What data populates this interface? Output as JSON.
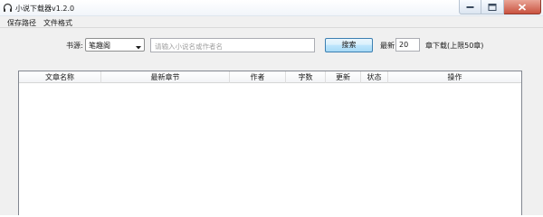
{
  "window": {
    "title": "小说下载器v1.2.0",
    "icon": "headphones-icon"
  },
  "menu": {
    "items": [
      "保存路径",
      "文件格式"
    ]
  },
  "toolbar": {
    "source_label": "书源:",
    "source_value": "笔趣阁",
    "search_placeholder": "请输入小说名或作者名",
    "search_button": "搜索",
    "latest_label": "最新",
    "latest_count": "20",
    "chapters_label": "章下载(上限50章)"
  },
  "table": {
    "columns": [
      "文章名称",
      "最新章节",
      "作者",
      "字数",
      "更新",
      "状态",
      "操作"
    ],
    "rows": []
  },
  "colors": {
    "button_accent": "#3c7fb1",
    "close_button": "#c9523f"
  }
}
